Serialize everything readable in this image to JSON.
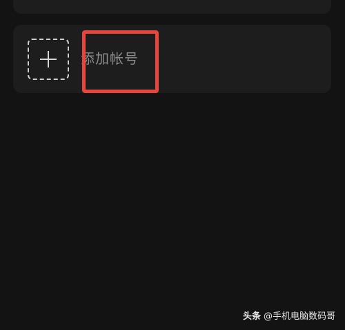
{
  "add_account": {
    "label": "添加帐号",
    "icon": "plus-icon"
  },
  "watermark": {
    "brand": "头条",
    "handle": "@手机电脑数码哥"
  },
  "colors": {
    "background": "#131313",
    "card": "#1d1d1d",
    "label": "#8b8b8b",
    "highlight": "#e8463c"
  }
}
